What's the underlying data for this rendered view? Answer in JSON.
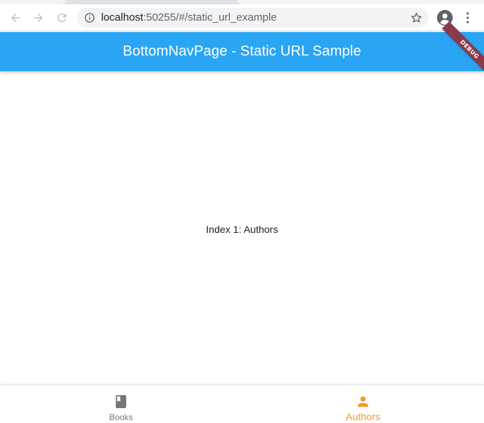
{
  "browser": {
    "url_host": "localhost",
    "url_rest": ":50255/#/static_url_example",
    "icons": {
      "back": "arrow-left-icon",
      "forward": "arrow-right-icon",
      "reload": "reload-icon",
      "info": "info-icon",
      "star": "star-icon",
      "profile": "profile-icon",
      "menu": "menu-dots-icon"
    }
  },
  "appbar": {
    "title": "BottomNavPage - Static URL Sample",
    "color": "#2aa5f3"
  },
  "debug_banner": {
    "label": "DEBUG",
    "color": "#8b3a4c"
  },
  "body": {
    "text": "Index 1: Authors"
  },
  "bottom_nav": {
    "items": [
      {
        "label": "Books",
        "icon": "book-icon",
        "selected": false,
        "color": "#757575"
      },
      {
        "label": "Authors",
        "icon": "person-icon",
        "selected": true,
        "color": "#f59a23"
      }
    ]
  }
}
